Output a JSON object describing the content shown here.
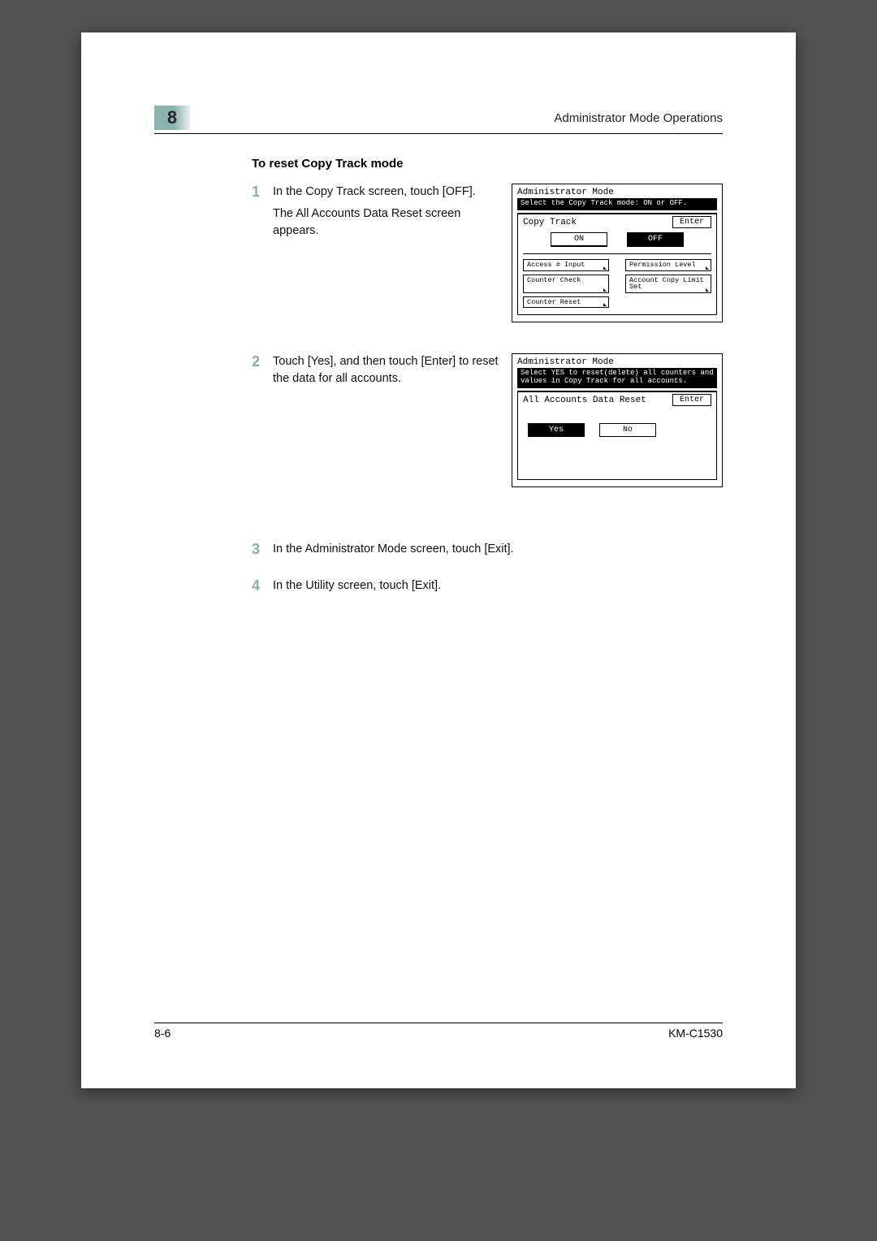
{
  "header": {
    "chapter_number": "8",
    "running_title": "Administrator Mode Operations"
  },
  "section": {
    "title": "To reset Copy Track mode"
  },
  "steps": [
    {
      "num": "1",
      "text": "In the Copy Track screen, touch [OFF].",
      "subtext": "The All Accounts Data Reset screen appears."
    },
    {
      "num": "2",
      "text": "Touch [Yes], and then touch [Enter] to reset the data for all accounts."
    },
    {
      "num": "3",
      "text": "In the Administrator Mode screen, touch [Exit]."
    },
    {
      "num": "4",
      "text": "In the Utility screen, touch [Exit]."
    }
  ],
  "lcd1": {
    "mode_title": "Administrator Mode",
    "message": "Select the Copy Track mode: ON or OFF.",
    "panel_label": "Copy Track",
    "enter": "Enter",
    "on": "ON",
    "off": "OFF",
    "buttons": [
      "Access #\nInput",
      "Permission\nLevel",
      "Counter\nCheck",
      "Account Copy\nLimit Set",
      "Counter\nReset"
    ]
  },
  "lcd2": {
    "mode_title": "Administrator Mode",
    "message": "Select YES to reset(delete) all counters and values in Copy Track for all accounts.",
    "panel_label": "All Accounts Data Reset",
    "enter": "Enter",
    "yes": "Yes",
    "no": "No"
  },
  "footer": {
    "page_num": "8-6",
    "model": "KM-C1530"
  }
}
